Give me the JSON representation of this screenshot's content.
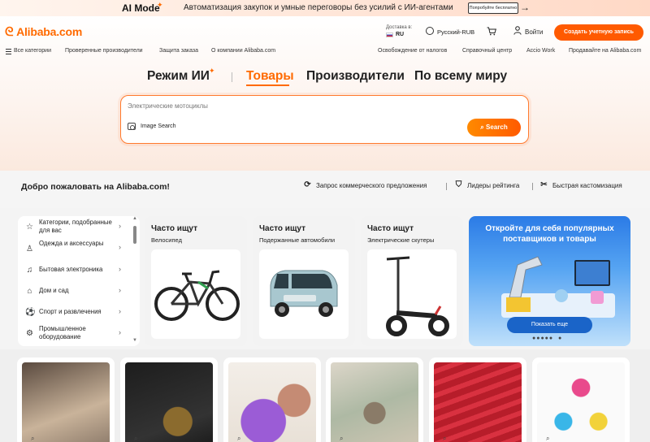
{
  "promo": {
    "ai_mode": "AI Mode",
    "text": "Автоматизация закупок и умные переговоры без усилий с ИИ-агентами",
    "button": "Попробуйте бесплатно"
  },
  "header": {
    "logo": "Alibaba.com",
    "delivery_label": "Доставка в:",
    "delivery_country": "RU",
    "language": "Русский-RUB",
    "login": "Войти",
    "create_account": "Создать учетную запись"
  },
  "nav": {
    "left": [
      "Все категории",
      "Проверенные производители",
      "Защита заказа",
      "О компании Alibaba.com"
    ],
    "right": [
      "Освобождение от налогов",
      "Справочный центр",
      "Accio Work",
      "Продавайте на Alibaba.com"
    ]
  },
  "modes": [
    "Режим ИИ",
    "Товары",
    "Производители",
    "По всему миру"
  ],
  "search": {
    "placeholder": "Электрические мотоциклы",
    "image_search": "Image Search",
    "button": "Search"
  },
  "welcome": {
    "title": "Добро пожаловать на Alibaba.com!",
    "links": [
      "Запрос коммерческого предложения",
      "Лидеры рейтинга",
      "Быстрая кастомизация"
    ]
  },
  "categories": [
    {
      "label": "Категории, подобранные для вас",
      "icon": "star-icon"
    },
    {
      "label": "Одежда и аксессуары",
      "icon": "dress-icon"
    },
    {
      "label": "Бытовая электроника",
      "icon": "headphones-icon"
    },
    {
      "label": "Дом и сад",
      "icon": "sofa-icon"
    },
    {
      "label": "Спорт и развлечения",
      "icon": "sports-icon"
    },
    {
      "label": "Промышленное оборудование",
      "icon": "machinery-icon"
    }
  ],
  "products": [
    {
      "title": "Часто ищут",
      "sub": "Велосипед"
    },
    {
      "title": "Часто ищут",
      "sub": "Подержанные автомобили"
    },
    {
      "title": "Часто ищут",
      "sub": "Электрические скутеры"
    }
  ],
  "ad": {
    "title": "Откройте для себя популярных поставщиков и товары",
    "button": "Показать еще"
  },
  "colors": {
    "accent": "#ff6a00",
    "ad_blue": "#2b7be6"
  }
}
